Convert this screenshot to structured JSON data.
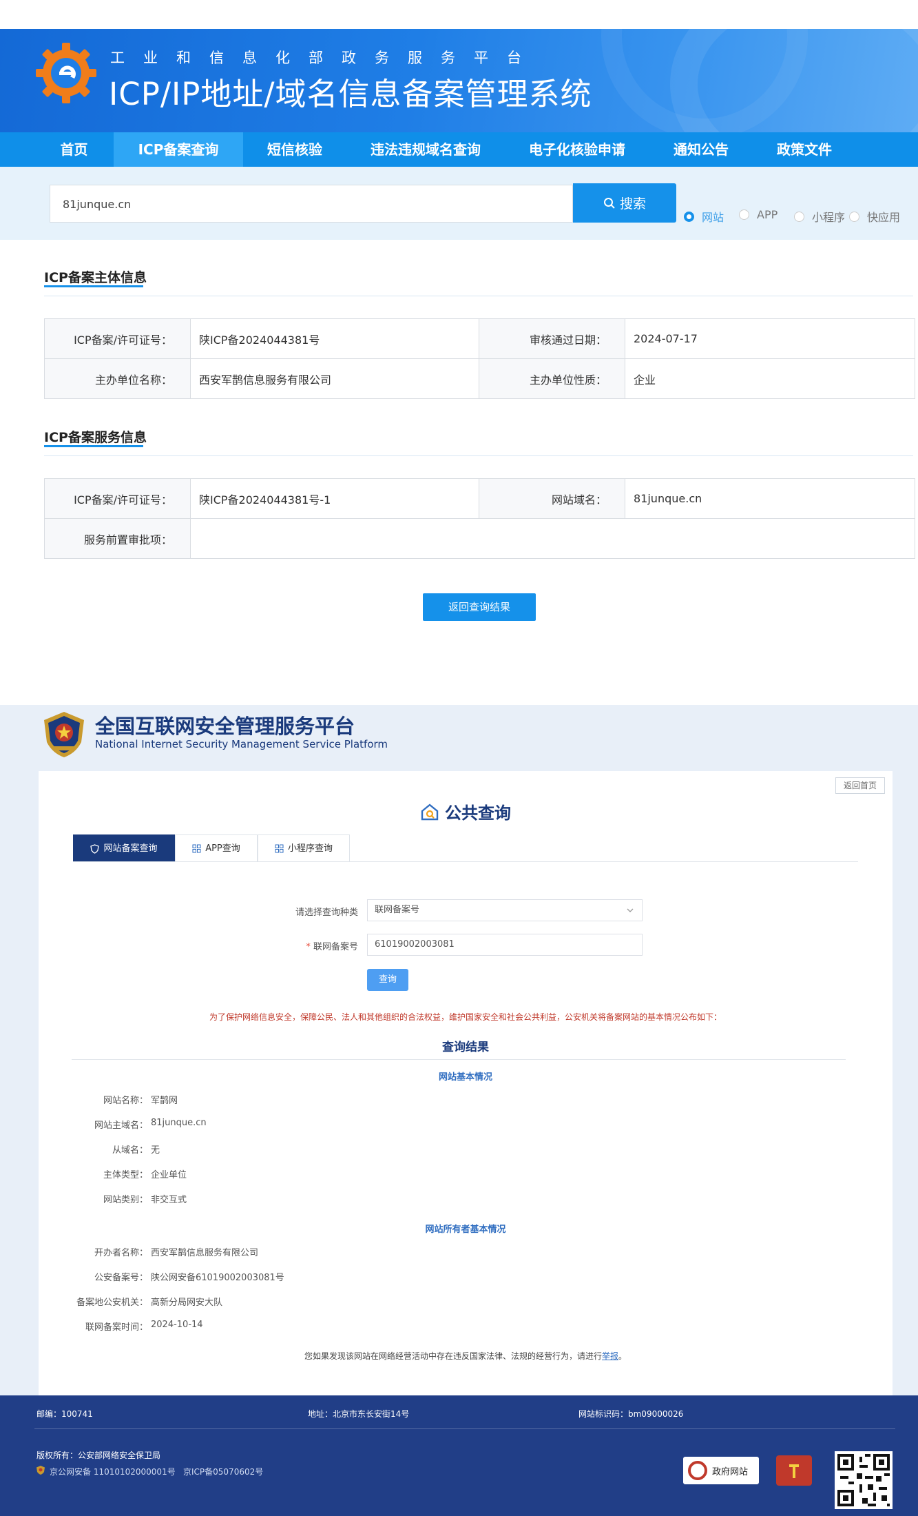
{
  "miit": {
    "subtitle": "工业和信息化部政务服务平台",
    "title": "ICP/IP地址/域名信息备案管理系统",
    "nav": [
      {
        "label": "首页",
        "active": false
      },
      {
        "label": "ICP备案查询",
        "active": true
      },
      {
        "label": "短信核验",
        "active": false
      },
      {
        "label": "违法违规域名查询",
        "active": false
      },
      {
        "label": "电子化核验申请",
        "active": false
      },
      {
        "label": "通知公告",
        "active": false
      },
      {
        "label": "政策文件",
        "active": false
      }
    ],
    "search": {
      "value": "81junque.cn",
      "button_label": "搜索",
      "options": [
        {
          "label": "网站",
          "checked": true
        },
        {
          "label": "APP",
          "checked": false
        },
        {
          "label": "小程序",
          "checked": false
        },
        {
          "label": "快应用",
          "checked": false
        }
      ]
    },
    "subject_info": {
      "title": "ICP备案主体信息",
      "license_label": "ICP备案/许可证号：",
      "license_value": "陕ICP备2024044381号",
      "approve_date_label": "审核通过日期：",
      "approve_date_value": "2024-07-17",
      "org_name_label": "主办单位名称：",
      "org_name_value": "西安军鹊信息服务有限公司",
      "org_type_label": "主办单位性质：",
      "org_type_value": "企业"
    },
    "service_info": {
      "title": "ICP备案服务信息",
      "license_label": "ICP备案/许可证号：",
      "license_value": "陕ICP备2024044381号-1",
      "domain_label": "网站域名：",
      "domain_value": "81junque.cn",
      "pre_approval_label": "服务前置审批项：",
      "pre_approval_value": ""
    },
    "back_button": "返回查询结果"
  },
  "mps": {
    "title": "全国互联网安全管理服务平台",
    "subtitle": "National Internet Security Management Service Platform",
    "home_button": "返回首页",
    "public_query_title": "公共查询",
    "tabs": [
      {
        "label": "网站备案查询",
        "active": true
      },
      {
        "label": "APP查询",
        "active": false
      },
      {
        "label": "小程序查询",
        "active": false
      }
    ],
    "form": {
      "type_label": "请选择查询种类",
      "type_value": "联网备案号",
      "record_label": "联网备案号",
      "record_required_mark": "*",
      "record_value": "61019002003081",
      "query_button": "查询"
    },
    "notice": "为了保护网络信息安全，保障公民、法人和其他组织的合法权益，维护国家安全和社会公共利益，公安机关将备案网站的基本情况公布如下：",
    "result_title": "查询结果",
    "site_basic": {
      "heading": "网站基本情况",
      "rows": [
        {
          "key": "网站名称：",
          "value": "军鹊网"
        },
        {
          "key": "网站主域名：",
          "value": "81junque.cn"
        },
        {
          "key": "从域名：",
          "value": "无"
        },
        {
          "key": "主体类型：",
          "value": "企业单位"
        },
        {
          "key": "网站类别：",
          "value": "非交互式"
        }
      ]
    },
    "owner_basic": {
      "heading": "网站所有者基本情况",
      "rows": [
        {
          "key": "开办者名称：",
          "value": "西安军鹊信息服务有限公司"
        },
        {
          "key": "公安备案号：",
          "value": "陕公网安备61019002003081号"
        },
        {
          "key": "备案地公安机关：",
          "value": "高新分局网安大队"
        },
        {
          "key": "联网备案时间：",
          "value": "2024-10-14"
        }
      ]
    },
    "report_text": "您如果发现该网站在网络经营活动中存在违反国家法律、法规的经营行为，请进行",
    "report_link": "举报",
    "report_end": "。",
    "footer": {
      "postcode": "邮编：100741",
      "address": "地址：北京市东长安街14号",
      "site_code": "网站标识码：bm09000026",
      "copyright": "版权所有：公安部网络安全保卫局",
      "police_record": "京公网安备 11010102000001号",
      "icp_record": "京ICP备05070602号",
      "gov_badge": "政府网站"
    }
  },
  "colors": {
    "miit_blue": "#1591ea",
    "mps_navy": "#1a3a7c",
    "mps_footer": "#213e87",
    "notice_red": "#c0392b"
  }
}
